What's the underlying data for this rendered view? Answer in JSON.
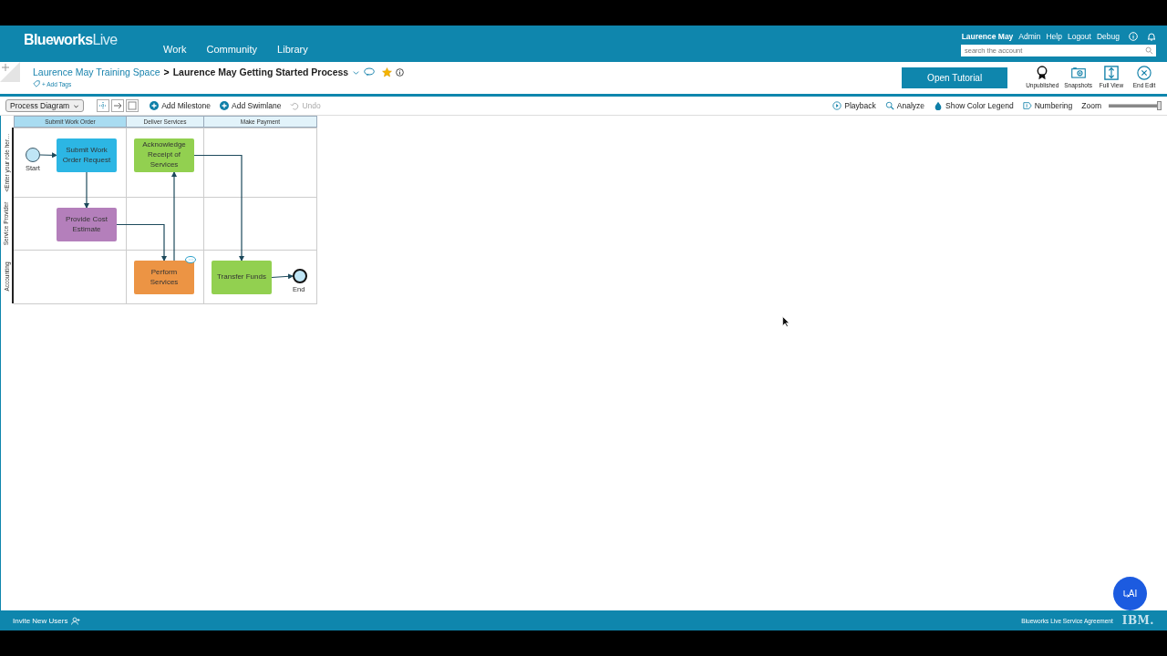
{
  "header": {
    "logo": {
      "primary": "Blueworks",
      "secondary": "Live"
    },
    "nav": [
      {
        "label": "Work"
      },
      {
        "label": "Community"
      },
      {
        "label": "Library"
      }
    ],
    "user_links": [
      {
        "label": "Laurence May",
        "kind": "user"
      },
      {
        "label": "Admin",
        "kind": "link"
      },
      {
        "label": "Help",
        "kind": "link"
      },
      {
        "label": "Logout",
        "kind": "link"
      },
      {
        "label": "Debug",
        "kind": "link"
      }
    ],
    "search": {
      "placeholder": "search the account"
    }
  },
  "breadcrumb": {
    "space": "Laurence May Training Space",
    "separator": ">",
    "process": "Laurence May Getting Started Process",
    "favorite": true,
    "add_tags": "+ Add Tags"
  },
  "actions": {
    "primary": "Open Tutorial",
    "items": [
      {
        "label": "Unpublished",
        "kind": "ribbon"
      },
      {
        "label": "Snapshots",
        "kind": "camera"
      },
      {
        "label": "Full View",
        "kind": "expand"
      },
      {
        "label": "End Edit",
        "kind": "close"
      }
    ]
  },
  "toolbar": {
    "view_select": "Process Diagram",
    "left": [
      {
        "label": "Add Milestone",
        "kind": "add",
        "disabled": false
      },
      {
        "label": "Add Swimlane",
        "kind": "add",
        "disabled": false
      },
      {
        "label": "Undo",
        "kind": "undo",
        "disabled": true
      }
    ],
    "right": [
      {
        "label": "Playback",
        "kind": "play"
      },
      {
        "label": "Analyze",
        "kind": "search"
      },
      {
        "label": "Show Color Legend",
        "kind": "drop"
      },
      {
        "label": "Numbering",
        "kind": "number"
      }
    ],
    "zoom": {
      "label": "Zoom",
      "level": 0.95
    }
  },
  "diagram": {
    "milestones": [
      {
        "label": "Submit Work Order",
        "selected": true
      },
      {
        "label": "Deliver Services",
        "selected": false
      },
      {
        "label": "Make Payment",
        "selected": false
      }
    ],
    "lanes": [
      {
        "label": "<Enter your role her…",
        "cells": [
          {
            "nodes": [
              {
                "kind": "start",
                "label": "Start"
              },
              {
                "kind": "task",
                "label": "Submit Work Order Request",
                "color": "#2cb6e4",
                "has_comment": false
              }
            ]
          },
          {
            "nodes": [
              {
                "kind": "task",
                "label": "Acknowledge Receipt of Services",
                "color": "#92d050",
                "has_comment": false
              }
            ]
          },
          {}
        ]
      },
      {
        "label": "Service Provider",
        "cells": [
          {
            "nodes": [
              {
                "kind": "task",
                "label": "Provide Cost Estimate",
                "color": "#b47fbb",
                "has_comment": false
              }
            ]
          },
          {},
          {}
        ]
      },
      {
        "label": "Accounting",
        "cells": [
          {},
          {
            "nodes": [
              {
                "kind": "task",
                "label": "Perform Services",
                "color": "#ec9444",
                "has_comment": true
              }
            ]
          },
          {
            "nodes": [
              {
                "kind": "task",
                "label": "Transfer Funds",
                "color": "#92d050",
                "has_comment": false
              },
              {
                "kind": "end",
                "label": "End"
              }
            ]
          }
        ]
      }
    ]
  },
  "footer": {
    "invite": "Invite New Users",
    "agreement": "Blueworks Live Service Agreement",
    "brand": "IBM.",
    "assistant": "AI"
  }
}
